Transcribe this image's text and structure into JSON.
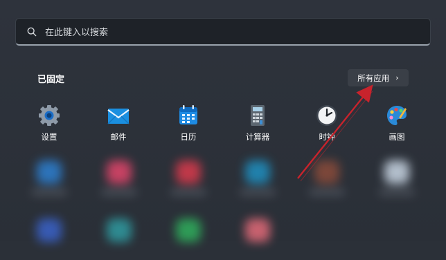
{
  "search": {
    "placeholder": "在此键入以搜索"
  },
  "pinned": {
    "title": "已固定",
    "all_apps_label": "所有应用",
    "all_apps_chevron": "›",
    "apps": [
      {
        "label": "设置",
        "icon": "gear-icon"
      },
      {
        "label": "邮件",
        "icon": "mail-icon"
      },
      {
        "label": "日历",
        "icon": "calendar-icon"
      },
      {
        "label": "计算器",
        "icon": "calculator-icon"
      },
      {
        "label": "时钟",
        "icon": "clock-icon"
      },
      {
        "label": "画图",
        "icon": "paint-palette-icon"
      }
    ]
  },
  "colors": {
    "arrow": "#c8232c",
    "accent": "#0078d4"
  }
}
